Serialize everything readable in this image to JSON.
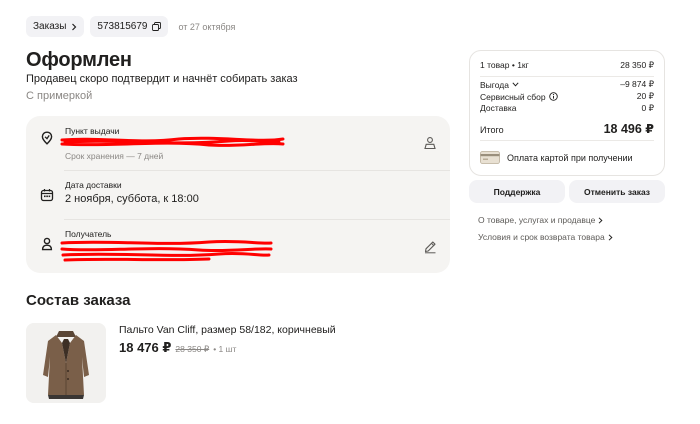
{
  "breadcrumb": {
    "orders_label": "Заказы",
    "order_number": "573815679",
    "order_date": "от 27 октября"
  },
  "status": {
    "title": "Оформлен",
    "subtitle": "Продавец скоро подтвердит и начнёт собирать заказ",
    "fitting": "С примеркой"
  },
  "pickup": {
    "label": "Пункт выдачи",
    "storage": "Срок хранения — 7 дней"
  },
  "delivery": {
    "label": "Дата доставки",
    "value": "2 ноября, суббота, к 18:00"
  },
  "recipient": {
    "label": "Получатель"
  },
  "composition": {
    "title": "Состав заказа",
    "product_name": "Пальто Van Cliff, размер 58/182, коричневый",
    "price_now": "18 476 ₽",
    "price_old": "28 350 ₽",
    "qty": "• 1 шт"
  },
  "summary": {
    "items_label": "1 товар • 1кг",
    "items_value": "28 350 ₽",
    "savings_label": "Выгода",
    "savings_value": "–9 874 ₽",
    "fee_label": "Сервисный сбор",
    "fee_value": "20 ₽",
    "delivery_label": "Доставка",
    "delivery_value": "0 ₽",
    "total_label": "Итого",
    "total_value": "18 496 ₽",
    "payment": "Оплата картой при получении"
  },
  "buttons": {
    "support": "Поддержка",
    "cancel": "Отменить заказ"
  },
  "links": {
    "about": "О товаре, услугах и продавце",
    "returns": "Условия и срок возврата товара"
  },
  "colors": {
    "redaction": "#ff0000",
    "card_bg": "#f5f4f2",
    "chip_bg": "#f2f2f5"
  }
}
